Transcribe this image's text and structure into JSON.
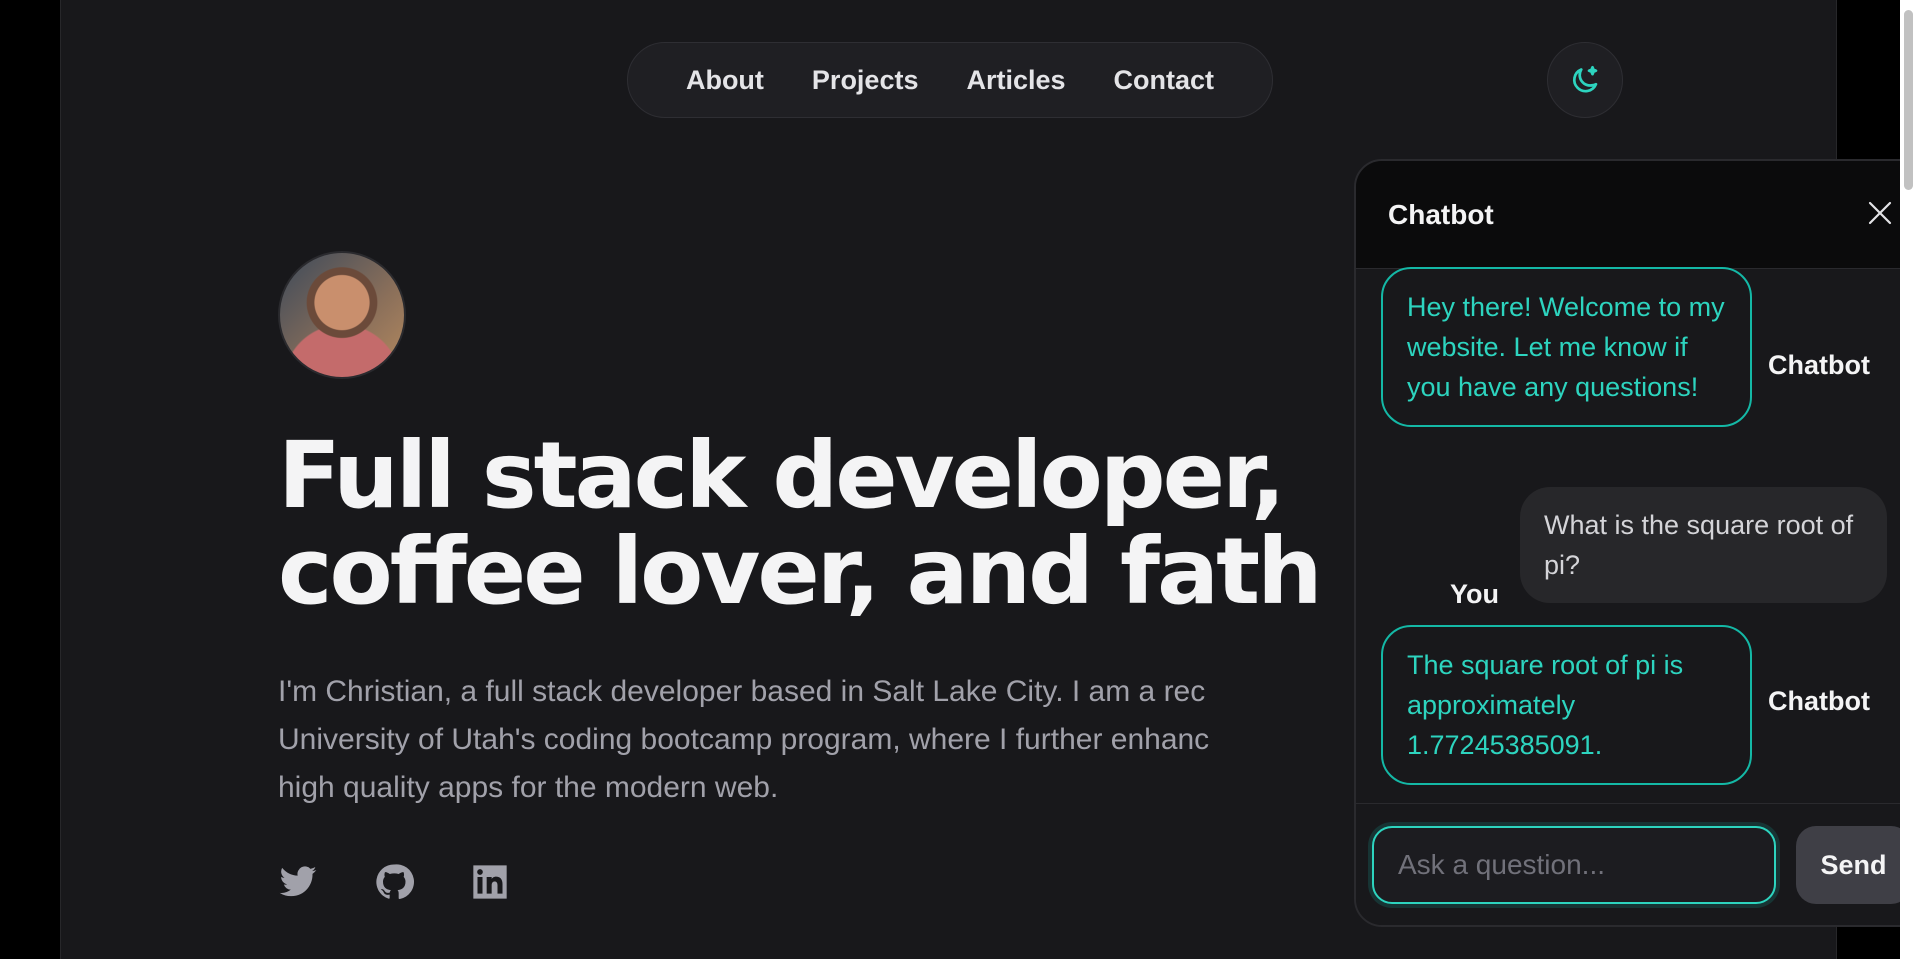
{
  "nav": {
    "items": [
      "About",
      "Projects",
      "Articles",
      "Contact"
    ]
  },
  "theme_toggle": {
    "icon": "moon-sparkle-icon"
  },
  "hero": {
    "headline_line1": "Full stack developer,",
    "headline_line2": "coffee lover, and fath",
    "intro_line1": "I'm Christian, a full stack developer based in Salt Lake City. I am a rec",
    "intro_line2": "University of Utah's coding bootcamp program, where I further enhanc",
    "intro_line3": "high quality apps for the modern web."
  },
  "socials": [
    "twitter-icon",
    "github-icon",
    "linkedin-icon"
  ],
  "chat": {
    "title": "Chatbot",
    "messages": [
      {
        "sender": "Chatbot",
        "text": "Hey there! Welcome to my website. Let me know if you have any questions!"
      },
      {
        "sender": "You",
        "text": "What is the square root of pi?"
      },
      {
        "sender": "Chatbot",
        "text": "The square root of pi is approximately 1.77245385091."
      }
    ],
    "input_placeholder": "Ask a question...",
    "send_label": "Send"
  },
  "colors": {
    "accent": "#14b8a6",
    "accent_text": "#2dd4bf",
    "background": "#18181b"
  }
}
